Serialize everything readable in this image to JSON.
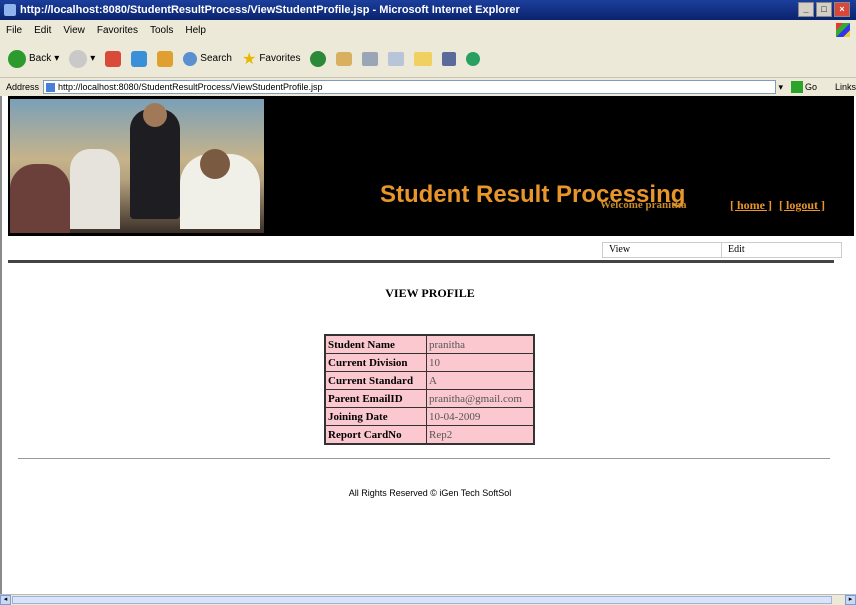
{
  "window": {
    "title": "http://localhost:8080/StudentResultProcess/ViewStudentProfile.jsp - Microsoft Internet Explorer"
  },
  "menu": [
    "File",
    "Edit",
    "View",
    "Favorites",
    "Tools",
    "Help"
  ],
  "toolbar": {
    "back": "Back",
    "search": "Search",
    "favorites": "Favorites"
  },
  "address": {
    "label": "Address",
    "url": "http://localhost:8080/StudentResultProcess/ViewStudentProfile.jsp",
    "go": "Go",
    "links": "Links"
  },
  "banner": {
    "title": "Student Result Processing",
    "welcome": "Welcome pranitha",
    "home": "[ home ]",
    "logout": "[ logout ]"
  },
  "subnav": [
    "View",
    "Edit"
  ],
  "profile": {
    "heading": "VIEW PROFILE",
    "rows": [
      {
        "label": "Student Name",
        "value": "pranitha"
      },
      {
        "label": "Current Division",
        "value": "10"
      },
      {
        "label": "Current Standard",
        "value": "A"
      },
      {
        "label": "Parent EmailID",
        "value": "pranitha@gmail.com"
      },
      {
        "label": "Joining Date",
        "value": "10-04-2009"
      },
      {
        "label": "Report CardNo",
        "value": "Rep2"
      }
    ]
  },
  "footer": "All Rights Reserved © iGen Tech SoftSol",
  "colors": {
    "banner_bg": "#000000",
    "title_orange": "#e8952a",
    "table_bg": "#fbc8cf"
  }
}
